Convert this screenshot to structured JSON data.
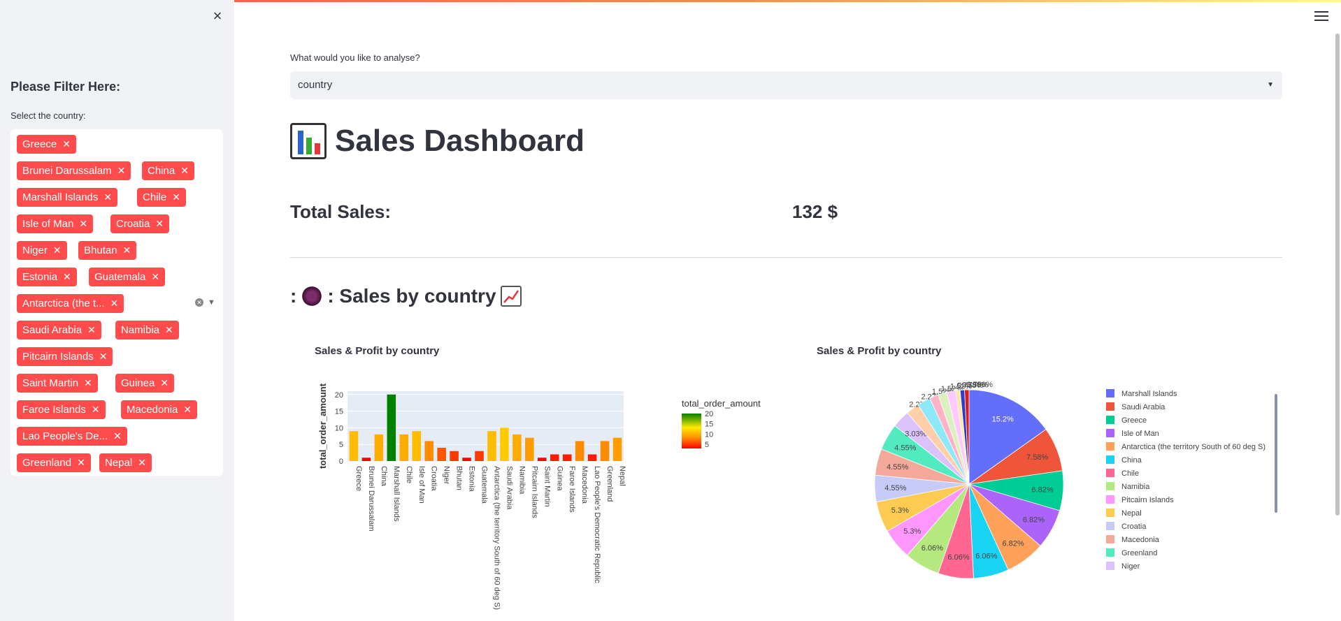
{
  "sidebar": {
    "title": "Please Filter Here:",
    "country_label": "Select the country:",
    "selected": [
      "Greece",
      "Brunei Darussalam",
      "China",
      "Marshall Islands",
      "Chile",
      "Isle of Man",
      "Croatia",
      "Niger",
      "Bhutan",
      "Estonia",
      "Guatemala",
      "Antarctica (the t...",
      "Saudi Arabia",
      "Namibia",
      "Pitcairn Islands",
      "Saint Martin",
      "Guinea",
      "Faroe Islands",
      "Macedonia",
      "Lao People's De...",
      "Greenland",
      "Nepal"
    ]
  },
  "main": {
    "question": "What would you like to analyse?",
    "select_value": "country",
    "title": "Sales Dashboard",
    "total_sales_label": "Total Sales:",
    "total_sales_value": "132 $",
    "subheader_prefix": ":",
    "subheader_text": ": Sales by country"
  },
  "colors": {
    "accent": "#ff4b4b",
    "sidebar_bg": "#f0f2f6"
  },
  "chart_data": [
    {
      "type": "bar",
      "title": "Sales & Profit by country",
      "ylabel": "total_order_amount",
      "colorbar_title": "total_order_amount",
      "colorbar_ticks": [
        "20",
        "15",
        "10",
        "5"
      ],
      "ylim": [
        0,
        21
      ],
      "yticks": [
        "20",
        "15",
        "10",
        "5",
        "0"
      ],
      "categories": [
        "Greece",
        "Brunei Darussalam",
        "China",
        "Marshall Islands",
        "Chile",
        "Isle of Man",
        "Croatia",
        "Niger",
        "Bhutan",
        "Estonia",
        "Guatemala",
        "Antarctica (the territory South of 60 deg S)",
        "Saudi Arabia",
        "Namibia",
        "Pitcairn Islands",
        "Saint Martin",
        "Guinea",
        "Faroe Islands",
        "Macedonia",
        "Lao People's Democratic Republic",
        "Greenland",
        "Nepal"
      ],
      "values": [
        9,
        1,
        8,
        20,
        8,
        9,
        6,
        4,
        3,
        1,
        3,
        9,
        10,
        8,
        7,
        1,
        2,
        2,
        6,
        2,
        6,
        7
      ]
    },
    {
      "type": "pie",
      "title": "Sales & Profit by country",
      "legend": [
        "Marshall Islands",
        "Saudi Arabia",
        "Greece",
        "Isle of Man",
        "Antarctica (the territory South of 60 deg S)",
        "China",
        "Chile",
        "Namibia",
        "Pitcairn Islands",
        "Nepal",
        "Croatia",
        "Macedonia",
        "Greenland",
        "Niger"
      ],
      "slices": [
        {
          "label": "15.2%",
          "value": 20,
          "color": "#636efa"
        },
        {
          "label": "7.58%",
          "value": 10,
          "color": "#ef553b"
        },
        {
          "label": "6.82%",
          "value": 9,
          "color": "#00cc96"
        },
        {
          "label": "6.82%",
          "value": 9,
          "color": "#ab63fa"
        },
        {
          "label": "6.82%",
          "value": 9,
          "color": "#ffa15a"
        },
        {
          "label": "6.06%",
          "value": 8,
          "color": "#19d3f3"
        },
        {
          "label": "6.06%",
          "value": 8,
          "color": "#ff6692"
        },
        {
          "label": "6.06%",
          "value": 8,
          "color": "#b6e880"
        },
        {
          "label": "5.3%",
          "value": 7,
          "color": "#ff97ff"
        },
        {
          "label": "5.3%",
          "value": 7,
          "color": "#fecb52"
        },
        {
          "label": "4.55%",
          "value": 6,
          "color": "#c6cbf7"
        },
        {
          "label": "4.55%",
          "value": 6,
          "color": "#f4a99a"
        },
        {
          "label": "4.55%",
          "value": 6,
          "color": "#52ebc0"
        },
        {
          "label": "3.03%",
          "value": 4,
          "color": "#dcc2fb"
        },
        {
          "label": "2.27%",
          "value": 3,
          "color": "#ffcfaa"
        },
        {
          "label": "2.27%",
          "value": 3,
          "color": "#8de8f8"
        },
        {
          "label": "1.52%",
          "value": 2,
          "color": "#ffb3c8"
        },
        {
          "label": "1.52%",
          "value": 2,
          "color": "#dbf2c0"
        },
        {
          "label": "1.52%",
          "value": 2,
          "color": "#ffcaff"
        },
        {
          "label": "0.758%",
          "value": 1,
          "color": "#ffe5a7"
        },
        {
          "label": "0.758%",
          "value": 1,
          "color": "#2b3ec9"
        },
        {
          "label": "0.758%",
          "value": 1,
          "color": "#d81b1b"
        }
      ]
    }
  ]
}
